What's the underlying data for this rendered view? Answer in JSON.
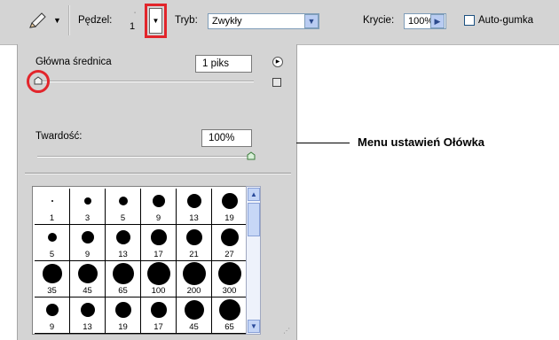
{
  "toolbar": {
    "brush_label": "Pędzel:",
    "brush_size": "1",
    "mode_label": "Tryb:",
    "mode_value": "Zwykły",
    "opacity_label": "Krycie:",
    "opacity_value": "100%",
    "autoerase_label": "Auto-gumka"
  },
  "panel": {
    "diameter_label": "Główna średnica",
    "diameter_value": "1 piks",
    "diameter_slider": 0.0,
    "hardness_label": "Twardość:",
    "hardness_value": "100%",
    "hardness_slider": 1.0
  },
  "brushes": [
    [
      "1",
      "3",
      "5",
      "9",
      "13",
      "19"
    ],
    [
      "5",
      "9",
      "13",
      "17",
      "21",
      "27"
    ],
    [
      "35",
      "45",
      "65",
      "100",
      "200",
      "300"
    ],
    [
      "9",
      "13",
      "19",
      "17",
      "45",
      "65"
    ]
  ],
  "callout": {
    "text": "Menu ustawień Ołówka"
  },
  "colors": {
    "highlight": "#e2252b",
    "toolbar_bg": "#d4d4d4"
  }
}
